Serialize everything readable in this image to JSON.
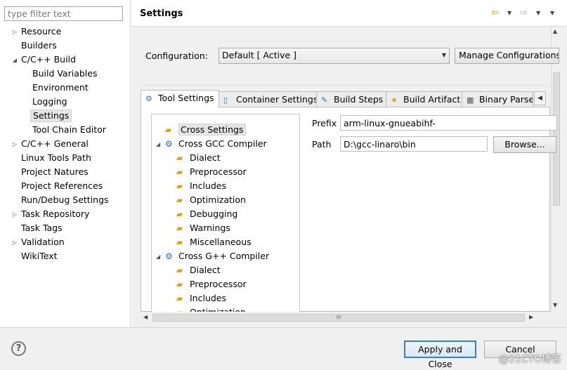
{
  "filter": {
    "placeholder": "type filter text"
  },
  "nav": {
    "items": [
      {
        "label": "Resource",
        "level": 0,
        "expander": "collapsed"
      },
      {
        "label": "Builders",
        "level": 0,
        "expander": "none"
      },
      {
        "label": "C/C++ Build",
        "level": 0,
        "expander": "expanded"
      },
      {
        "label": "Build Variables",
        "level": 1,
        "expander": "none"
      },
      {
        "label": "Environment",
        "level": 1,
        "expander": "none"
      },
      {
        "label": "Logging",
        "level": 1,
        "expander": "none"
      },
      {
        "label": "Settings",
        "level": 1,
        "expander": "none",
        "selected": true
      },
      {
        "label": "Tool Chain Editor",
        "level": 1,
        "expander": "none"
      },
      {
        "label": "C/C++ General",
        "level": 0,
        "expander": "collapsed"
      },
      {
        "label": "Linux Tools Path",
        "level": 0,
        "expander": "none"
      },
      {
        "label": "Project Natures",
        "level": 0,
        "expander": "none"
      },
      {
        "label": "Project References",
        "level": 0,
        "expander": "none"
      },
      {
        "label": "Run/Debug Settings",
        "level": 0,
        "expander": "none"
      },
      {
        "label": "Task Repository",
        "level": 0,
        "expander": "collapsed"
      },
      {
        "label": "Task Tags",
        "level": 0,
        "expander": "none"
      },
      {
        "label": "Validation",
        "level": 0,
        "expander": "collapsed"
      },
      {
        "label": "WikiText",
        "level": 0,
        "expander": "none"
      }
    ]
  },
  "header": {
    "title": "Settings"
  },
  "config": {
    "label": "Configuration:",
    "value": "Default  [ Active ]",
    "manage_label": "Manage Configurations..."
  },
  "tabs": [
    {
      "label": "Tool Settings",
      "icon": "gear-icon",
      "active": true
    },
    {
      "label": "Container Settings",
      "icon": "container-icon"
    },
    {
      "label": "Build Steps",
      "icon": "build-steps-icon"
    },
    {
      "label": "Build Artifact",
      "icon": "artifact-icon"
    },
    {
      "label": "Binary Parse",
      "icon": "binary-icon"
    }
  ],
  "tool_tree": [
    {
      "label": "Cross Settings",
      "level": 0,
      "icon": "folder-icon",
      "expander": "none",
      "selected": true
    },
    {
      "label": "Cross GCC Compiler",
      "level": 0,
      "icon": "gear-icon",
      "expander": "expanded"
    },
    {
      "label": "Dialect",
      "level": 1,
      "icon": "folder-icon"
    },
    {
      "label": "Preprocessor",
      "level": 1,
      "icon": "folder-icon"
    },
    {
      "label": "Includes",
      "level": 1,
      "icon": "folder-icon"
    },
    {
      "label": "Optimization",
      "level": 1,
      "icon": "folder-icon"
    },
    {
      "label": "Debugging",
      "level": 1,
      "icon": "folder-icon"
    },
    {
      "label": "Warnings",
      "level": 1,
      "icon": "folder-icon"
    },
    {
      "label": "Miscellaneous",
      "level": 1,
      "icon": "folder-icon"
    },
    {
      "label": "Cross G++ Compiler",
      "level": 0,
      "icon": "gear-icon",
      "expander": "expanded"
    },
    {
      "label": "Dialect",
      "level": 1,
      "icon": "folder-icon"
    },
    {
      "label": "Preprocessor",
      "level": 1,
      "icon": "folder-icon"
    },
    {
      "label": "Includes",
      "level": 1,
      "icon": "folder-icon"
    },
    {
      "label": "Optimization",
      "level": 1,
      "icon": "folder-icon"
    }
  ],
  "fields": {
    "prefix_label": "Prefix",
    "prefix_value": "arm-linux-gnueabihf-",
    "path_label": "Path",
    "path_value": "D:\\gcc-linaro\\bin",
    "browse_label": "Browse..."
  },
  "hscroll_grip": "III",
  "footer": {
    "help_label": "?",
    "apply_label": "Apply and Close",
    "cancel_label": "Cancel"
  },
  "watermark": "@51CTO博客"
}
